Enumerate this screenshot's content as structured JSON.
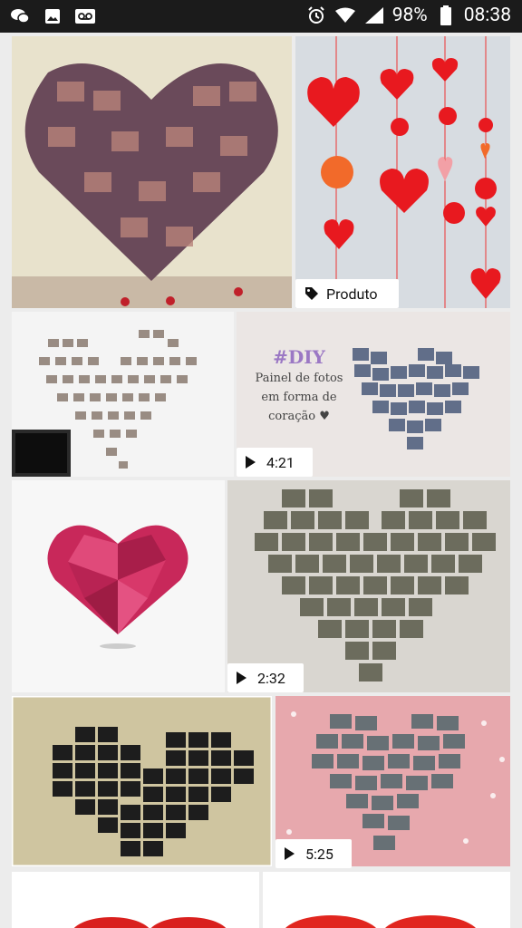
{
  "status_bar": {
    "battery_percent": "98%",
    "time": "08:38",
    "left_icons": [
      "chat-icon",
      "image-icon",
      "voicemail-icon"
    ],
    "right_icons": [
      "alarm-icon",
      "wifi-icon",
      "signal-icon",
      "battery-icon"
    ]
  },
  "results": [
    {
      "name": "result-1",
      "badge": ""
    },
    {
      "name": "result-2",
      "badge": "Produto",
      "badge_icon": "tag-icon"
    },
    {
      "name": "result-3",
      "badge": ""
    },
    {
      "name": "result-4",
      "badge": "4:21",
      "badge_icon": "play-icon",
      "overlay": {
        "hash": "#DIY",
        "lines": [
          "Painel de fotos",
          "em forma de",
          "coração ♥"
        ]
      }
    },
    {
      "name": "result-5",
      "badge": ""
    },
    {
      "name": "result-6",
      "badge": "2:32",
      "badge_icon": "play-icon"
    },
    {
      "name": "result-7",
      "badge": ""
    },
    {
      "name": "result-8",
      "badge": "5:25",
      "badge_icon": "play-icon"
    },
    {
      "name": "result-9",
      "badge": ""
    },
    {
      "name": "result-10",
      "badge": ""
    }
  ]
}
